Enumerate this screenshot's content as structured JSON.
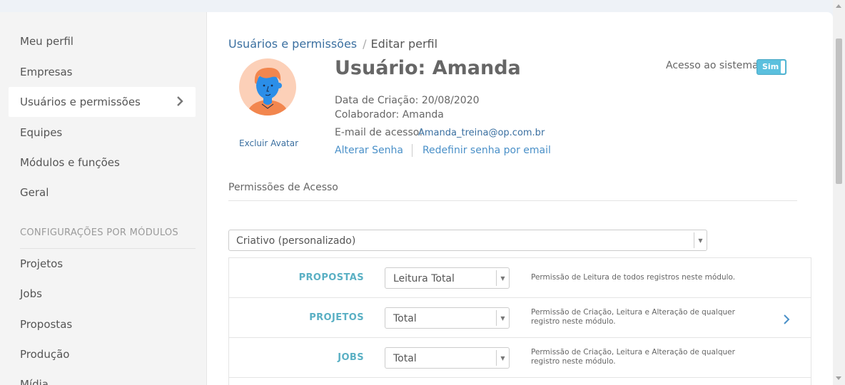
{
  "sidebar": {
    "items": [
      {
        "label": "Meu perfil"
      },
      {
        "label": "Empresas"
      },
      {
        "label": "Usuários e permissões"
      },
      {
        "label": "Equipes"
      },
      {
        "label": "Módulos e funções"
      },
      {
        "label": "Geral"
      }
    ],
    "section_label": "CONFIGURAÇÕES POR MÓDULOS",
    "module_items": [
      {
        "label": "Projetos"
      },
      {
        "label": "Jobs"
      },
      {
        "label": "Propostas"
      },
      {
        "label": "Produção"
      },
      {
        "label": "Mídia"
      }
    ]
  },
  "breadcrumb": {
    "parent": "Usuários e permissões",
    "separator": "/",
    "current": "Editar perfil"
  },
  "avatar": {
    "delete_label": "Excluir Avatar"
  },
  "user": {
    "title": "Usuário: Amanda",
    "created": "Data de Criação: 20/08/2020",
    "collaborator": "Colaborador: Amanda",
    "email_label": "E-mail de acesso:",
    "email": "Amanda_treina@op.com.br",
    "change_password": "Alterar Senha",
    "reset_password": "Redefinir senha por email"
  },
  "access": {
    "label": "Acesso ao sistema:",
    "toggle_label": "Sim"
  },
  "permissions": {
    "title": "Permissões de Acesso",
    "profile": "Criativo (personalizado)",
    "modules": [
      {
        "name": "PROPOSTAS",
        "level": "Leitura Total",
        "description": "Permissão de Leitura de todos registros neste módulo."
      },
      {
        "name": "PROJETOS",
        "level": "Total",
        "description": "Permissão de Criação, Leitura e Alteração de qualquer registro neste módulo."
      },
      {
        "name": "JOBS",
        "level": "Total",
        "description": "Permissão de Criação, Leitura e Alteração de qualquer registro neste módulo."
      }
    ]
  },
  "colors": {
    "link": "#3a6fa0",
    "module_name": "#5ab0c4",
    "toggle": "#5bc0de"
  },
  "icons": {
    "nav_active": "chevron-right-icon",
    "select": "caret-down-icon",
    "row_expand": "chevron-right-icon"
  }
}
